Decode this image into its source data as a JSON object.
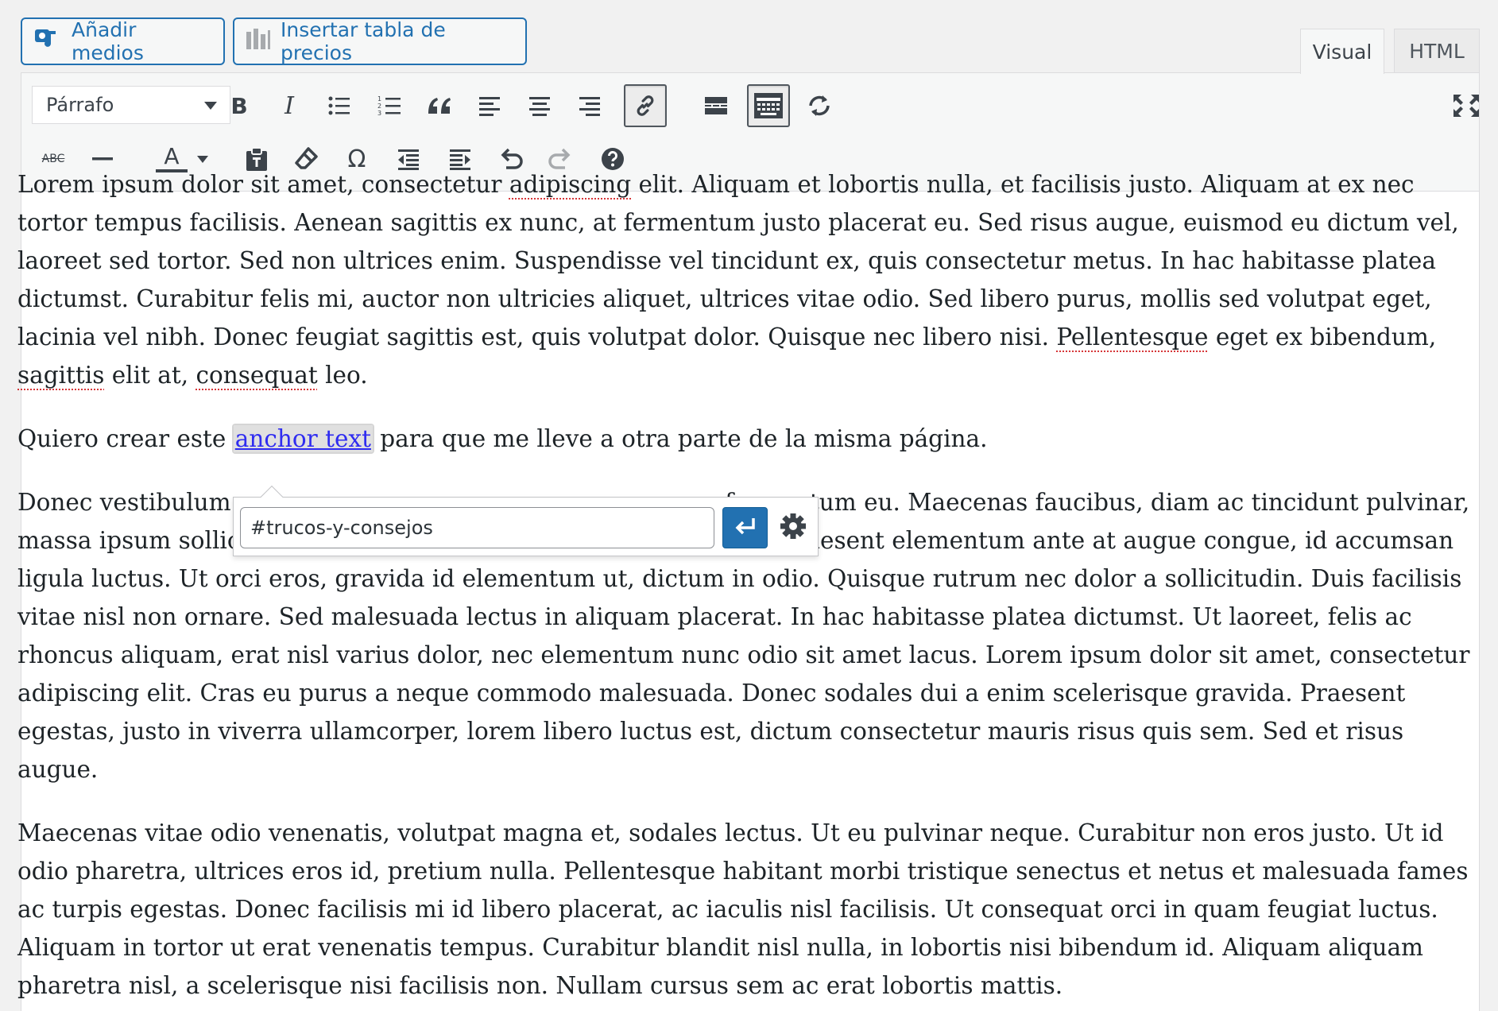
{
  "media_buttons": {
    "add_media": "Añadir medios",
    "insert_pricing_table": "Insertar tabla de precios"
  },
  "editor_tabs": {
    "visual": "Visual",
    "html": "HTML",
    "active": "Visual"
  },
  "toolbar": {
    "format_select": "Párrafo",
    "row1_icons": [
      "bold-icon",
      "italic-icon",
      "bulleted-list-icon",
      "numbered-list-icon",
      "blockquote-icon",
      "align-left-icon",
      "align-center-icon",
      "align-right-icon",
      "link-icon",
      "read-more-icon",
      "toolbar-toggle-icon",
      "refresh-icon",
      "fullscreen-icon"
    ],
    "row2_icons": [
      "strikethrough-icon",
      "horizontal-line-icon",
      "text-color-icon",
      "paste-text-icon",
      "clear-formatting-icon",
      "special-character-icon",
      "outdent-icon",
      "indent-icon",
      "undo-icon",
      "redo-icon",
      "help-icon"
    ],
    "pressed": [
      "link-icon",
      "toolbar-toggle-icon"
    ],
    "disabled": [
      "redo-icon"
    ],
    "strikethrough_glyph": "ABC",
    "bold_glyph": "B",
    "italic_glyph": "I",
    "text_color_glyph": "A",
    "omega_glyph": "Ω"
  },
  "colors": {
    "accent": "#2271b1",
    "link": "#2f2cf0",
    "spellcheck": "#d63638"
  },
  "content": {
    "p1_a": "Lorem ipsum dolor sit amet, consectetur ",
    "p1_spell1": "adipiscing",
    "p1_b": " elit. Aliquam et lobortis nulla, et facilisis justo. Aliquam at ex nec tortor tempus facilisis. Aenean sagittis ex nunc, at fermentum justo placerat eu. Sed risus augue, euismod eu dictum vel, laoreet sed tortor. Sed non ultrices enim. Suspendisse vel tincidunt ex, quis consectetur metus. In hac habitasse platea dictumst. Curabitur felis mi, auctor non ultricies aliquet, ultrices vitae odio. Sed libero purus, mollis sed volutpat eget, lacinia vel nibh. Donec feugiat sagittis est, quis volutpat dolor. Quisque nec libero nisi. ",
    "p1_spell2": "Pellentesque",
    "p1_c": " eget ex bibendum, ",
    "p1_spell3": "sagittis",
    "p1_d": " elit at, ",
    "p1_spell4": "consequat",
    "p1_e": " leo.",
    "p2_a": "Quiero crear este ",
    "p2_link": "anchor text",
    "p2_b": " para que me lleve a otra parte de la misma página.",
    "p3_a": "Donec vestibulum",
    "p3_b": "us quam fermentum eu. Maecenas faucibus, diam ac tincidunt pulvinar, massa ipsum sollicitudin massa, quis rutrum risus est ac quam. Praesent elementum ante at augue congue, id accumsan ligula luctus. Ut orci eros, gravida id elementum ut, dictum in odio. Quisque rutrum nec dolor a sollicitudin. Duis facilisis vitae nisl non ornare. Sed malesuada lectus in aliquam placerat. In hac habitasse platea dictumst. Ut laoreet, felis ac rhoncus aliquam, erat nisl varius dolor, nec elementum nunc odio sit amet lacus. Lorem ipsum dolor sit amet, consectetur adipiscing elit. Cras eu purus a neque commodo malesuada. Donec sodales dui a enim scelerisque gravida. Praesent egestas, justo in viverra ullamcorper, lorem libero luctus est, dictum consectetur mauris risus quis sem. Sed et risus augue.",
    "p4": "Maecenas vitae odio venenatis, volutpat magna et, sodales lectus. Ut eu pulvinar neque. Curabitur non eros justo. Ut id odio pharetra, ultrices eros id, pretium nulla. Pellentesque habitant morbi tristique senectus et netus et malesuada fames ac turpis egestas. Donec facilisis mi id libero placerat, ac iaculis nisl facilisis. Ut consequat orci in quam feugiat luctus. Aliquam in tortor ut erat venenatis tempus. Curabitur blandit nisl nulla, in lobortis nisi bibendum id. Aliquam aliquam pharetra nisl, a scelerisque nisi facilisis non. Nullam cursus sem ac erat lobortis mattis."
  },
  "link_popup": {
    "url_value": "#trucos-y-consejos",
    "apply_icon": "enter-icon",
    "settings_icon": "gear-icon"
  }
}
